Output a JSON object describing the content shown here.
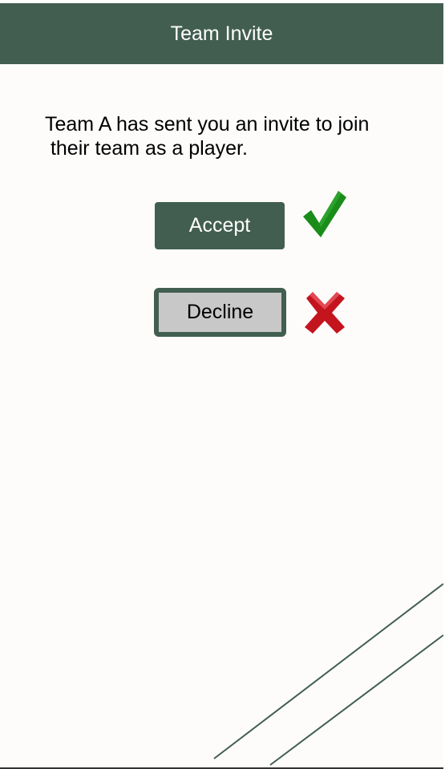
{
  "header": {
    "title": "Team Invite"
  },
  "invite": {
    "message": "Team A has sent you an invite to join\n their team as a player."
  },
  "actions": {
    "accept_label": "Accept",
    "decline_label": "Decline",
    "accept_icon": "checkmark-icon",
    "decline_icon": "x-icon"
  },
  "colors": {
    "brand": "#425e50",
    "accept_icon": "#1a8c1a",
    "decline_icon": "#d0202a",
    "decline_button": "#c8c8c8"
  }
}
